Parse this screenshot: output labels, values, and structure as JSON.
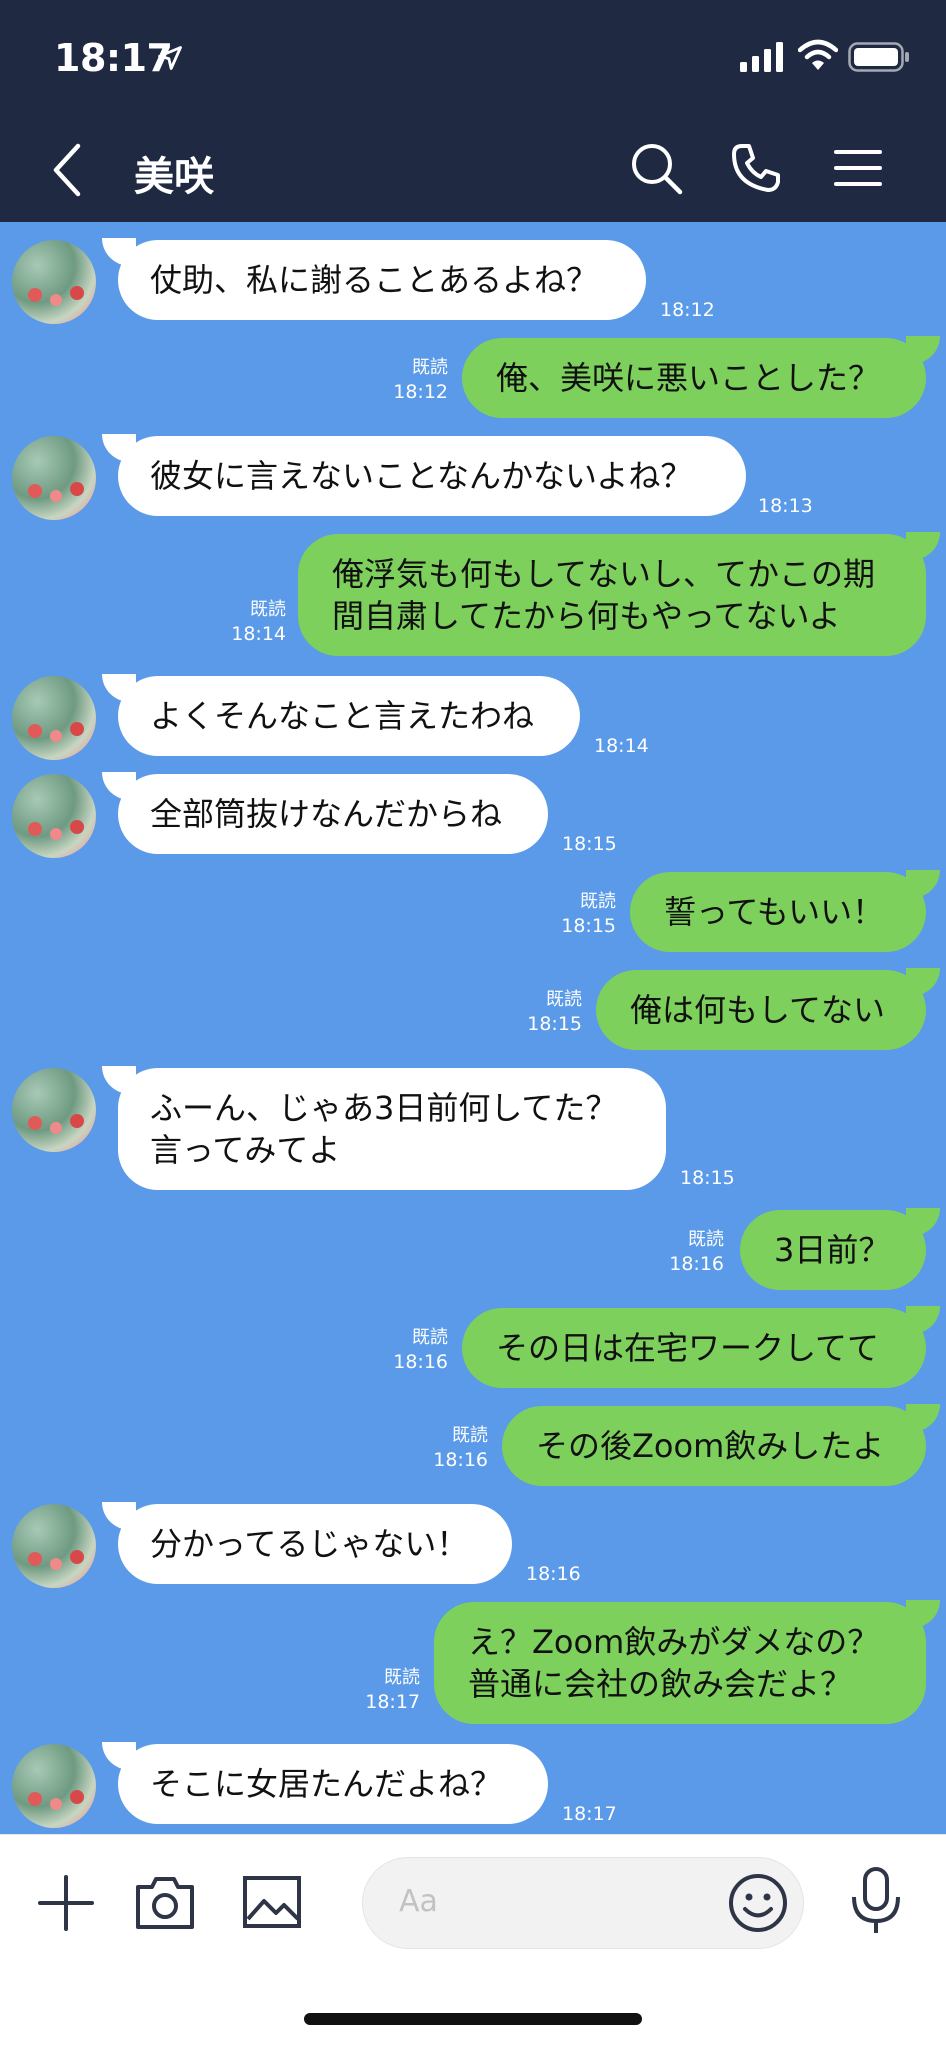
{
  "status": {
    "time": "18:17"
  },
  "header": {
    "title": "美咲"
  },
  "messages": [
    {
      "dir": "in",
      "text": "仗助、私に謝ることあるよね？",
      "time": "18:12"
    },
    {
      "dir": "out",
      "text": "俺、美咲に悪いことした？",
      "read": "既読",
      "time": "18:12"
    },
    {
      "dir": "in",
      "text": "彼女に言えないことなんかないよね？",
      "time": "18:13"
    },
    {
      "dir": "out",
      "text": "俺浮気も何もしてないし、てかこの期\n間自粛してたから何もやってないよ",
      "read": "既読",
      "time": "18:14"
    },
    {
      "dir": "in",
      "text": "よくそんなこと言えたわね",
      "time": "18:14"
    },
    {
      "dir": "in",
      "text": "全部筒抜けなんだからね",
      "time": "18:15"
    },
    {
      "dir": "out",
      "text": "誓ってもいい！",
      "read": "既読",
      "time": "18:15"
    },
    {
      "dir": "out",
      "text": "俺は何もしてない",
      "read": "既読",
      "time": "18:15"
    },
    {
      "dir": "in",
      "text": "ふーん、じゃあ3日前何してた？\n言ってみてよ",
      "time": "18:15"
    },
    {
      "dir": "out",
      "text": "3日前？",
      "read": "既読",
      "time": "18:16"
    },
    {
      "dir": "out",
      "text": "その日は在宅ワークしてて",
      "read": "既読",
      "time": "18:16"
    },
    {
      "dir": "out",
      "text": "その後Zoom飲みしたよ",
      "read": "既読",
      "time": "18:16"
    },
    {
      "dir": "in",
      "text": "分かってるじゃない！",
      "time": "18:16"
    },
    {
      "dir": "out",
      "text": "え？Zoom飲みがダメなの？\n普通に会社の飲み会だよ？",
      "read": "既読",
      "time": "18:17"
    },
    {
      "dir": "in",
      "text": "そこに女居たんだよね？",
      "time": "18:17"
    }
  ],
  "input": {
    "placeholder": "Aa"
  },
  "icons": {
    "back": "chevron-left-icon",
    "search": "search-icon",
    "call": "phone-icon",
    "menu": "hamburger-menu-icon",
    "plus": "plus-icon",
    "camera": "camera-icon",
    "image": "image-icon",
    "emoji": "emoji-icon",
    "mic": "microphone-icon"
  },
  "colors": {
    "header_bg": "#1f2942",
    "chat_bg": "#5a9ae8",
    "bubble_in": "#ffffff",
    "bubble_out": "#7ed05c"
  }
}
